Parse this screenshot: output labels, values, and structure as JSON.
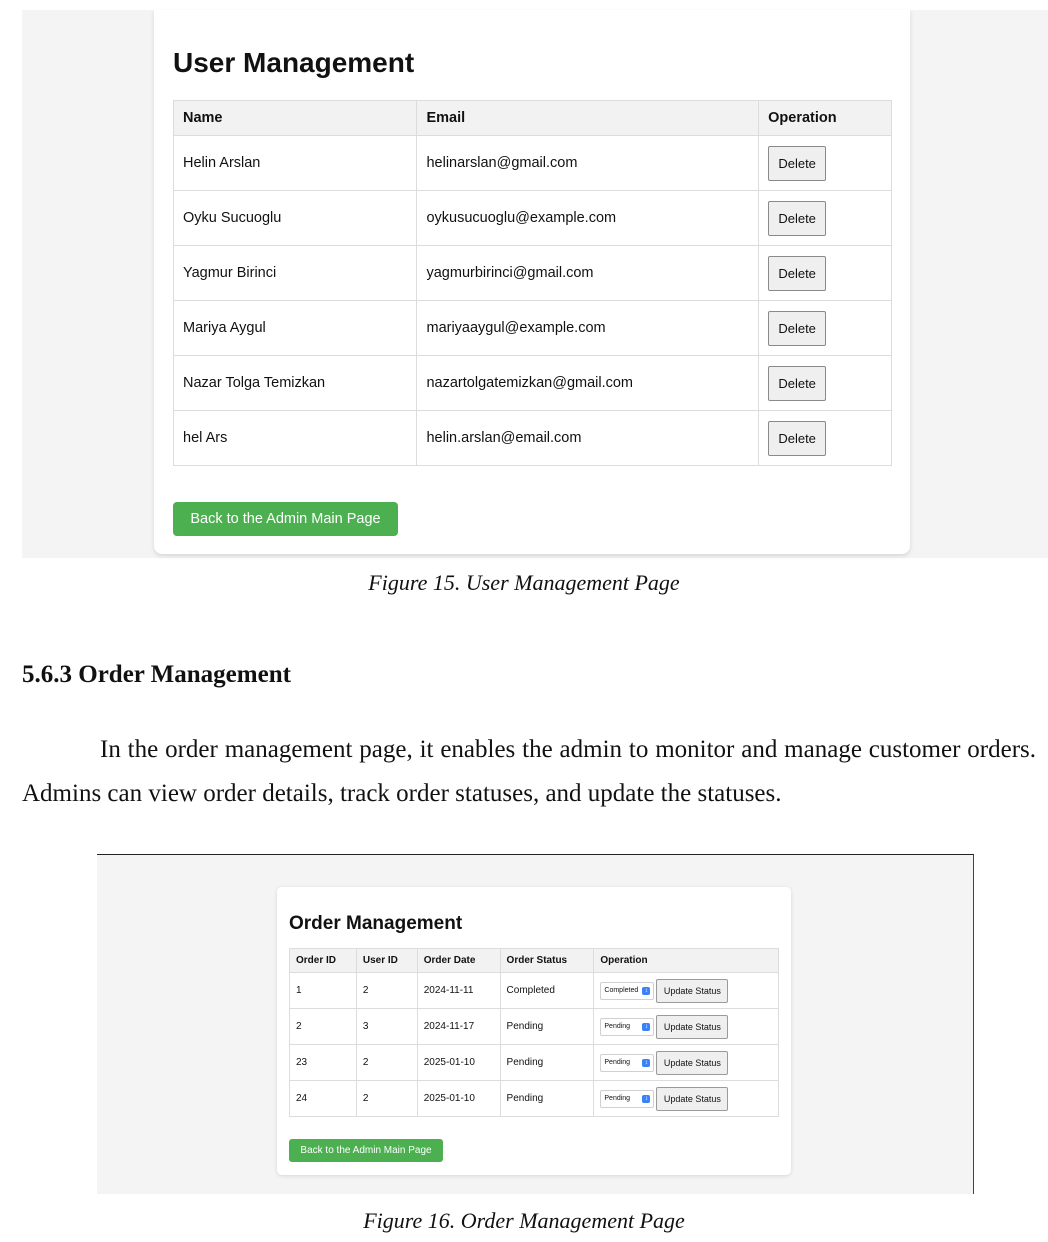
{
  "figure15": {
    "title": "User Management",
    "columns": [
      "Name",
      "Email",
      "Operation"
    ],
    "rows": [
      {
        "name": "Helin Arslan",
        "email": "helinarslan@gmail.com",
        "action": "Delete"
      },
      {
        "name": "Oyku Sucuoglu",
        "email": "oykusucuoglu@example.com",
        "action": "Delete"
      },
      {
        "name": "Yagmur Birinci",
        "email": "yagmurbirinci@gmail.com",
        "action": "Delete"
      },
      {
        "name": "Mariya Aygul",
        "email": "mariyaaygul@example.com",
        "action": "Delete"
      },
      {
        "name": "Nazar Tolga Temizkan",
        "email": "nazartolgatemizkan@gmail.com",
        "action": "Delete"
      },
      {
        "name": "hel Ars",
        "email": "helin.arslan@email.com",
        "action": "Delete"
      }
    ],
    "back_button": "Back to the Admin Main Page",
    "caption": "Figure 15. User Management Page",
    "button_color": "#4caf50"
  },
  "section": {
    "heading": "5.6.3 Order Management",
    "paragraph": "In the order management page, it enables the admin to monitor and manage customer orders. Admins can view order details, track order statuses, and update the statuses."
  },
  "figure16": {
    "title": "Order Management",
    "columns": [
      "Order ID",
      "User ID",
      "Order Date",
      "Order Status",
      "Operation"
    ],
    "rows": [
      {
        "order_id": "1",
        "user_id": "2",
        "date": "2024-11-11",
        "status": "Completed",
        "select": "Completed",
        "action": "Update Status"
      },
      {
        "order_id": "2",
        "user_id": "3",
        "date": "2024-11-17",
        "status": "Pending",
        "select": "Pending",
        "action": "Update Status"
      },
      {
        "order_id": "23",
        "user_id": "2",
        "date": "2025-01-10",
        "status": "Pending",
        "select": "Pending",
        "action": "Update Status"
      },
      {
        "order_id": "24",
        "user_id": "2",
        "date": "2025-01-10",
        "status": "Pending",
        "select": "Pending",
        "action": "Update Status"
      }
    ],
    "back_button": "Back to the Admin Main Page",
    "caption": "Figure 16. Order Management Page",
    "select_icon": "chevron-updown-icon",
    "select_icon_color": "#3b82f6"
  }
}
